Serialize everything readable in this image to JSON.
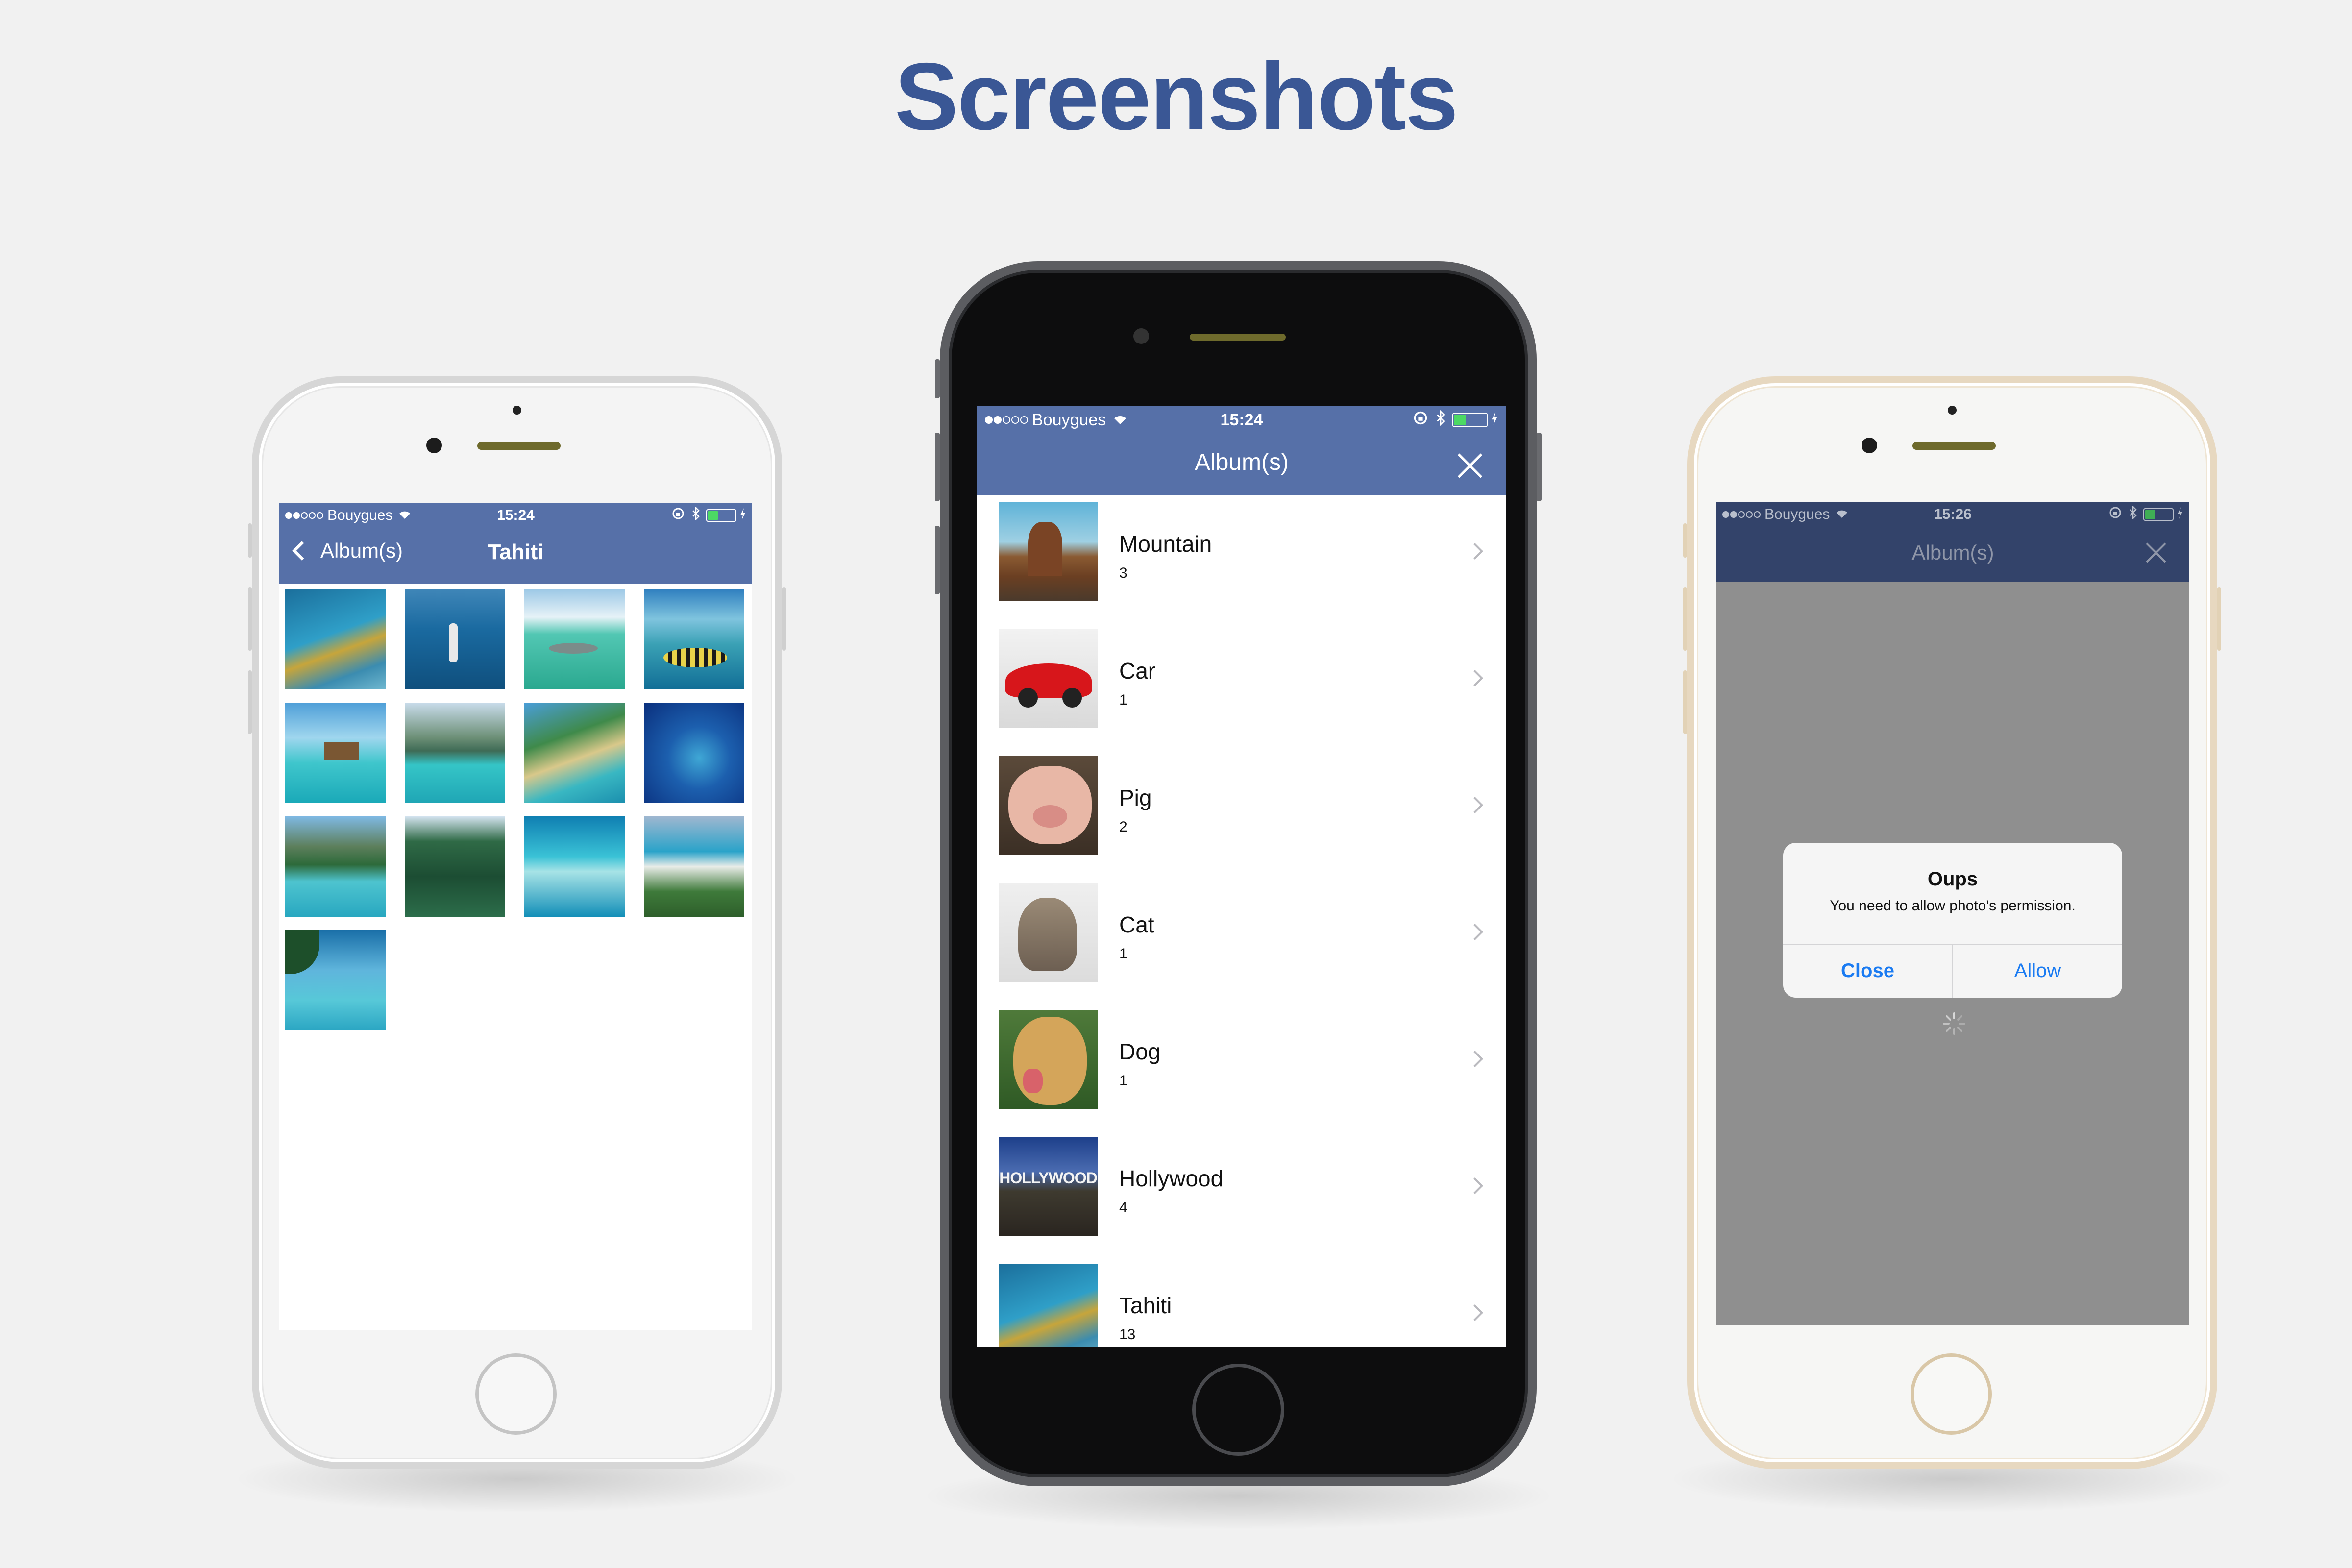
{
  "headline": "Screenshots",
  "colors": {
    "background": "#f1f1f1",
    "headline": "#3a5795",
    "nav_bar": "#5670a8",
    "nav_bar_dimmed": "#33436a",
    "alert_button": "#1a7bf2",
    "battery": "#4cd964"
  },
  "phone_left": {
    "finish": "silver",
    "status": {
      "carrier": "Bouygues",
      "time": "15:24"
    },
    "nav": {
      "back_label": "Album(s)",
      "title": "Tahiti"
    },
    "thumbnails": [
      "diver-with-fish",
      "sailing-boat-lagoon",
      "shark-in-lagoon",
      "island-tropical-fish",
      "overwater-bungalows",
      "bora-bora-lagoon",
      "palm-beach-snorkeler",
      "atoll-aerial",
      "mountain-palms-paddle",
      "green-peaks",
      "motu-aerial",
      "resort-pool-aerial",
      "palm-lounge-pool"
    ]
  },
  "phone_mid": {
    "finish": "space-gray",
    "status": {
      "carrier": "Bouygues",
      "time": "15:24"
    },
    "nav": {
      "title": "Album(s)",
      "close_icon": "close-icon"
    },
    "albums": [
      {
        "name": "Mountain",
        "count": "3",
        "thumb": "desert-butte"
      },
      {
        "name": "Car",
        "count": "1",
        "thumb": "red-sports-car"
      },
      {
        "name": "Pig",
        "count": "2",
        "thumb": "pig-face"
      },
      {
        "name": "Cat",
        "count": "1",
        "thumb": "tabby-cat"
      },
      {
        "name": "Dog",
        "count": "1",
        "thumb": "golden-retriever"
      },
      {
        "name": "Hollywood",
        "count": "4",
        "thumb": "hollywood-sign",
        "thumb_text": "HOLLYWOOD"
      },
      {
        "name": "Tahiti",
        "count": "13",
        "thumb": "diver-with-fish"
      }
    ]
  },
  "phone_right": {
    "finish": "gold",
    "status": {
      "carrier": "Bouygues",
      "time": "15:26"
    },
    "nav": {
      "title": "Album(s)",
      "close_icon": "close-icon"
    },
    "alert": {
      "title": "Oups",
      "message": "You need to allow photo's permission.",
      "close_label": "Close",
      "allow_label": "Allow"
    }
  }
}
